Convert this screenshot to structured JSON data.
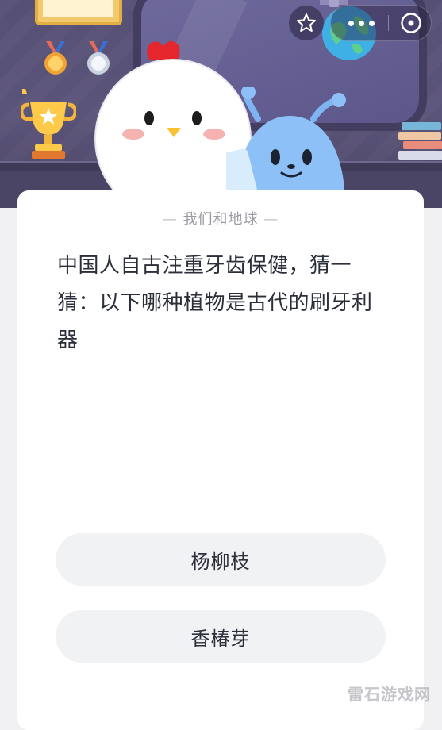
{
  "header": {
    "star_icon": "star-icon",
    "more_icon": "more-dots-icon",
    "close_icon": "close-circle-icon"
  },
  "card": {
    "category": "我们和地球",
    "question": "中国人自古注重牙齿保健，猜一猜：以下哪种植物是古代的刷牙利器",
    "options": [
      {
        "label": "杨柳枝"
      },
      {
        "label": "香椿芽"
      }
    ]
  },
  "watermark": "雷石游戏网",
  "colors": {
    "hero_bg": "#565075",
    "card_bg": "#ffffff",
    "option_bg": "#f1f2f4",
    "question_text": "#2b2f3a",
    "category_text": "#9a9aa4"
  }
}
